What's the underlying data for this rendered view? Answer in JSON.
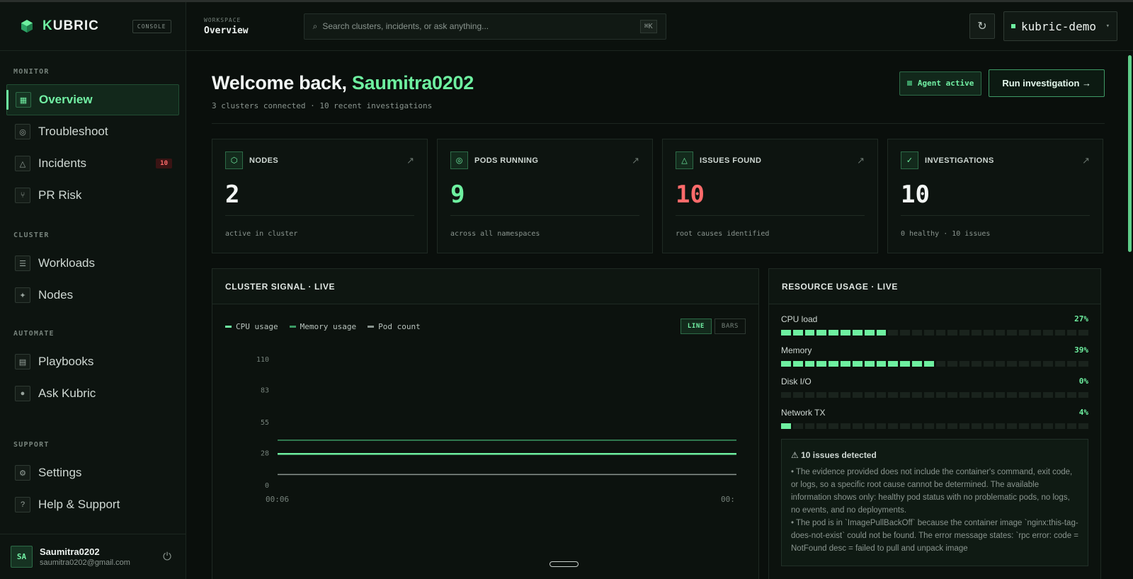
{
  "brand": {
    "name_k": "K",
    "name_rest": "UBRIC",
    "tag": "CONSOLE"
  },
  "nav": {
    "sections": {
      "monitor": "MONITOR",
      "cluster": "CLUSTER",
      "automate": "AUTOMATE",
      "support": "SUPPORT"
    },
    "items": {
      "overview": "Overview",
      "troubleshoot": "Troubleshoot",
      "incidents": "Incidents",
      "incidents_badge": "10",
      "pr_risk": "PR Risk",
      "workloads": "Workloads",
      "nodes": "Nodes",
      "playbooks": "Playbooks",
      "ask_kubric": "Ask Kubric",
      "settings": "Settings",
      "help": "Help & Support"
    }
  },
  "user": {
    "initials": "SA",
    "name": "Saumitra0202",
    "email": "saumitra0202@gmail.com"
  },
  "topbar": {
    "workspace_label": "WORKSPACE",
    "workspace_title": "Overview",
    "search_placeholder": "Search clusters, incidents, or ask anything...",
    "search_kbd": "⌘K",
    "cluster": "kubric-demo"
  },
  "welcome": {
    "prefix": "Welcome back, ",
    "name": "Saumitra0202",
    "subtitle": "3 clusters connected · 10 recent investigations",
    "agent_label": "Agent active",
    "run_label": "Run investigation →"
  },
  "stats": [
    {
      "label": "NODES",
      "value": "2",
      "sub": "active in cluster"
    },
    {
      "label": "PODS RUNNING",
      "value": "9",
      "sub": "across all namespaces"
    },
    {
      "label": "ISSUES FOUND",
      "value": "10",
      "sub": "root causes identified"
    },
    {
      "label": "INVESTIGATIONS",
      "value": "10",
      "sub": "0 healthy · 10 issues"
    }
  ],
  "signal": {
    "title": "CLUSTER SIGNAL · LIVE",
    "toggle_line": "LINE",
    "toggle_bars": "BARS"
  },
  "chart_data": {
    "type": "line",
    "title": "CLUSTER SIGNAL · LIVE",
    "ylim": [
      0,
      110
    ],
    "yticks": [
      "110",
      "83",
      "55",
      "28",
      "0"
    ],
    "xticks": [
      "00:06",
      "00:"
    ],
    "series": [
      {
        "name": "CPU usage",
        "color": "#6ef0a0",
        "values": [
          27,
          27
        ]
      },
      {
        "name": "Memory usage",
        "color": "#3c9a64",
        "values": [
          39,
          39
        ]
      },
      {
        "name": "Pod count",
        "color": "#8a958f",
        "values": [
          9,
          9
        ]
      }
    ]
  },
  "resource": {
    "title": "RESOURCE USAGE · LIVE",
    "rows": [
      {
        "label": "CPU load",
        "pct": "27%",
        "value": 0.27
      },
      {
        "label": "Memory",
        "pct": "39%",
        "value": 0.39
      },
      {
        "label": "Disk I/O",
        "pct": "0%",
        "value": 0.0
      },
      {
        "label": "Network TX",
        "pct": "4%",
        "value": 0.04
      }
    ],
    "issues_title": "⚠ 10 issues detected",
    "issues_lines": [
      "• The evidence provided does not include the container's command, exit code, or logs, so a specific root cause cannot be determined. The available information shows only: healthy pod status with no problematic pods, no logs, no events, and no deployments.",
      "• The pod is in `ImagePullBackOff` because the container image `nginx:this-tag-does-not-exist` could not be found. The error message states: `rpc error: code = NotFound desc = failed to pull and unpack image"
    ]
  },
  "colors": {
    "accent": "#6ef0a0",
    "danger": "#ff6b6b",
    "bg": "#0a0f0c"
  }
}
